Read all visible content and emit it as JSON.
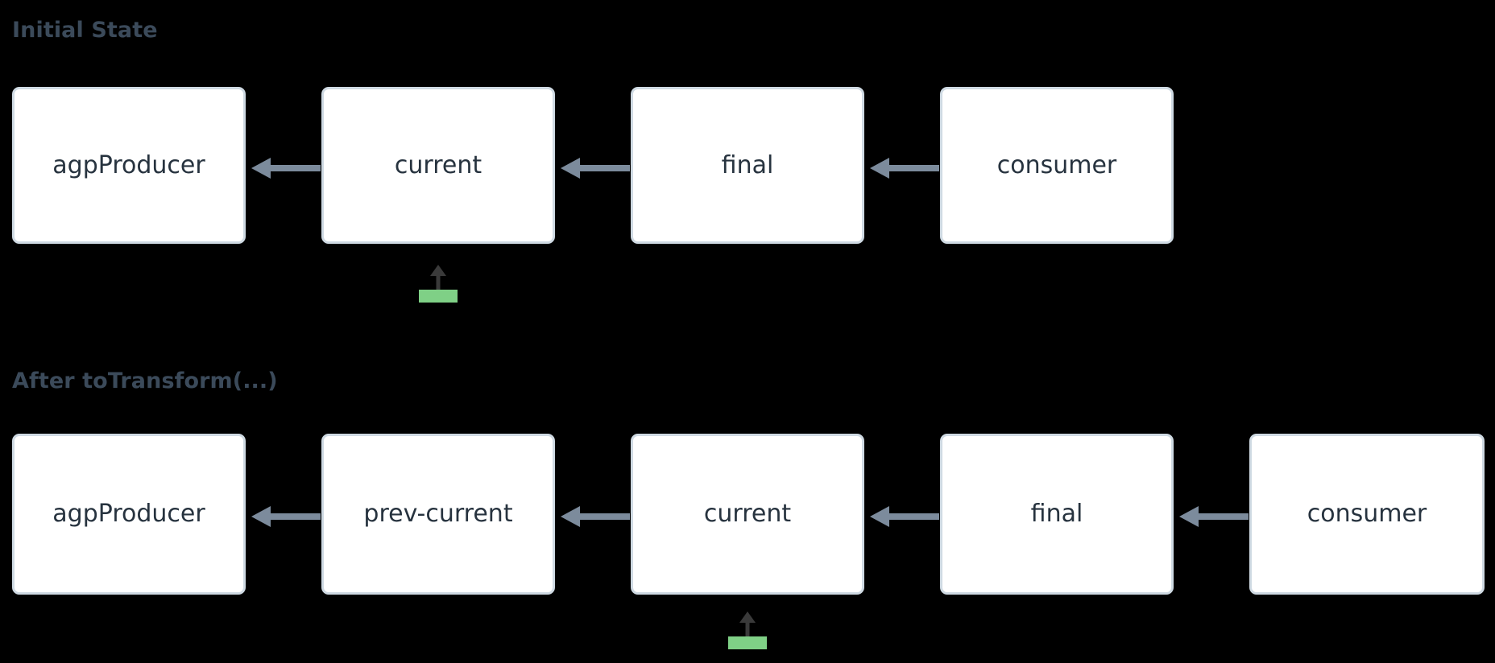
{
  "theme": {
    "background": "#000000",
    "title_color": "#3b4a5a",
    "box_fill": "#ffffff",
    "box_border": "#cfdae3",
    "label_color": "#27333f",
    "arrow_color": "#7c8b9c",
    "marker_green": "#7fd086",
    "marker_arrow_color": "#3a3a3a"
  },
  "diagram": {
    "type": "linked-list-chain",
    "sections": [
      {
        "id": "initial-state",
        "title": "Initial State",
        "nodes": [
          {
            "id": "n1-agpproducer",
            "label": "agpProducer"
          },
          {
            "id": "n1-current",
            "label": "current"
          },
          {
            "id": "n1-final",
            "label": "final"
          },
          {
            "id": "n1-consumer",
            "label": "consumer"
          }
        ],
        "edges": [
          {
            "from": "n1-current",
            "to": "n1-agpproducer",
            "direction": "left"
          },
          {
            "from": "n1-final",
            "to": "n1-current",
            "direction": "left"
          },
          {
            "from": "n1-consumer",
            "to": "n1-final",
            "direction": "left"
          }
        ],
        "markers": [
          {
            "id": "marker-initial-current",
            "target": "n1-current",
            "type": "pointer-up"
          }
        ]
      },
      {
        "id": "after-totransform",
        "title": "After toTransform(...)",
        "nodes": [
          {
            "id": "n2-agpproducer",
            "label": "agpProducer"
          },
          {
            "id": "n2-prev-current",
            "label": "prev-current"
          },
          {
            "id": "n2-current",
            "label": "current"
          },
          {
            "id": "n2-final",
            "label": "final"
          },
          {
            "id": "n2-consumer",
            "label": "consumer"
          }
        ],
        "edges": [
          {
            "from": "n2-prev-current",
            "to": "n2-agpproducer",
            "direction": "left"
          },
          {
            "from": "n2-current",
            "to": "n2-prev-current",
            "direction": "left"
          },
          {
            "from": "n2-final",
            "to": "n2-current",
            "direction": "left"
          },
          {
            "from": "n2-consumer",
            "to": "n2-final",
            "direction": "left"
          }
        ],
        "markers": [
          {
            "id": "marker-after-current",
            "target": "n2-current",
            "type": "pointer-up"
          }
        ]
      }
    ]
  }
}
